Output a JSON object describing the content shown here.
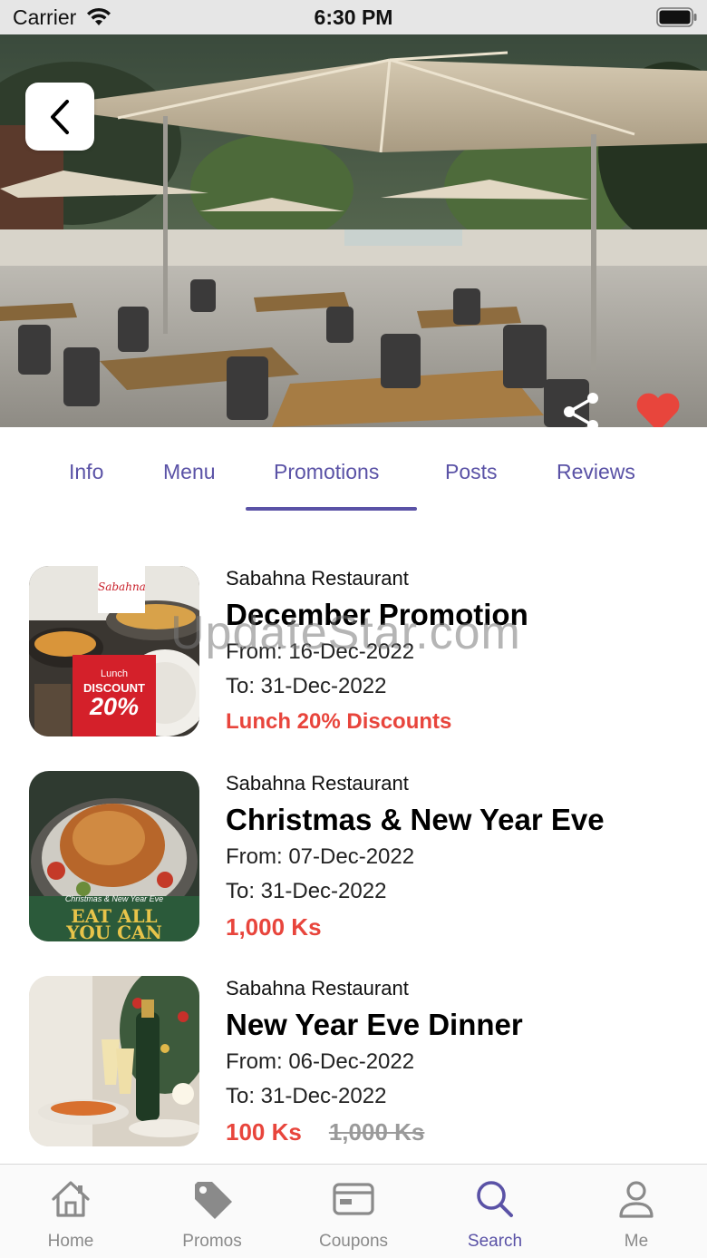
{
  "status_bar": {
    "carrier": "Carrier",
    "time": "6:30 PM"
  },
  "hero": {
    "image": "restaurant-patio-photo",
    "favorite_color": "#e8453c"
  },
  "tabs": {
    "items": [
      {
        "label": "Info"
      },
      {
        "label": "Menu"
      },
      {
        "label": "Promotions"
      },
      {
        "label": "Posts"
      },
      {
        "label": "Reviews"
      }
    ],
    "active": "Promotions",
    "accent_color": "#5a52a6"
  },
  "promotions": [
    {
      "restaurant": "Sabahna Restaurant",
      "title": "December Promotion",
      "from": "From: 16-Dec-2022",
      "to": "To: 31-Dec-2022",
      "price": "Lunch 20% Discounts",
      "thumb": {
        "brand": "Sabahna",
        "small": "Lunch",
        "big1": "DISCOUNT",
        "big2": "20%"
      }
    },
    {
      "restaurant": "Sabahna Restaurant",
      "title": "Christmas & New Year Eve",
      "from": "From: 07-Dec-2022",
      "to": "To: 31-Dec-2022",
      "price": "1,000 Ks",
      "thumb": {
        "small": "Christmas & New Year Eve",
        "big1": "EAT ALL",
        "big2": "YOU CAN"
      }
    },
    {
      "restaurant": "Sabahna Restaurant",
      "title": "New Year Eve Dinner",
      "from": "From: 06-Dec-2022",
      "to": "To: 31-Dec-2022",
      "price": "100 Ks",
      "old_price": "1,000 Ks"
    }
  ],
  "watermark": "UpdateStar.com",
  "tab_bar": {
    "items": [
      {
        "label": "Home",
        "icon": "home-icon"
      },
      {
        "label": "Promos",
        "icon": "tag-icon"
      },
      {
        "label": "Coupons",
        "icon": "coupon-icon"
      },
      {
        "label": "Search",
        "icon": "search-icon"
      },
      {
        "label": "Me",
        "icon": "person-icon"
      }
    ],
    "active": "Search"
  }
}
